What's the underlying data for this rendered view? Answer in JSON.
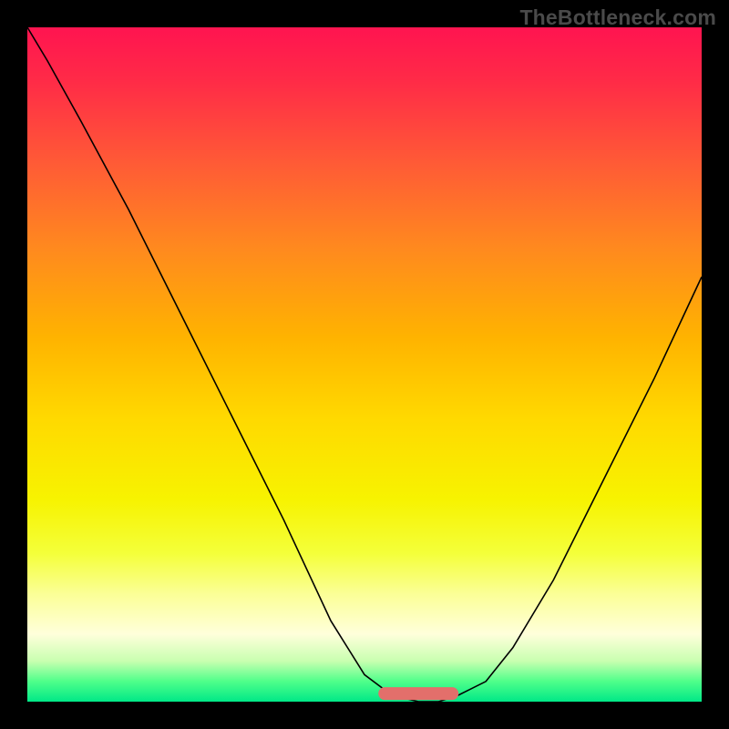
{
  "watermark": "TheBottleneck.com",
  "chart_data": {
    "type": "line",
    "title": "",
    "xlabel": "",
    "ylabel": "",
    "xlim": [
      0,
      100
    ],
    "ylim": [
      0,
      100
    ],
    "grid": false,
    "legend": false,
    "series": [
      {
        "name": "curve",
        "x": [
          0,
          3,
          8,
          15,
          22,
          30,
          38,
          45,
          50,
          54,
          58,
          61,
          64,
          68,
          72,
          78,
          86,
          93,
          100
        ],
        "values": [
          100,
          95,
          86,
          73,
          59,
          43,
          27,
          12,
          4,
          1,
          0,
          0,
          1,
          3,
          8,
          18,
          34,
          48,
          63
        ]
      },
      {
        "name": "highlight-flat-region",
        "x": [
          53,
          63
        ],
        "values": [
          1.2,
          1.2
        ]
      }
    ],
    "colors": {
      "curve": "#000000",
      "highlight": "#E36F6B",
      "gradient_top": "#ff1450",
      "gradient_bottom": "#00e887"
    }
  }
}
